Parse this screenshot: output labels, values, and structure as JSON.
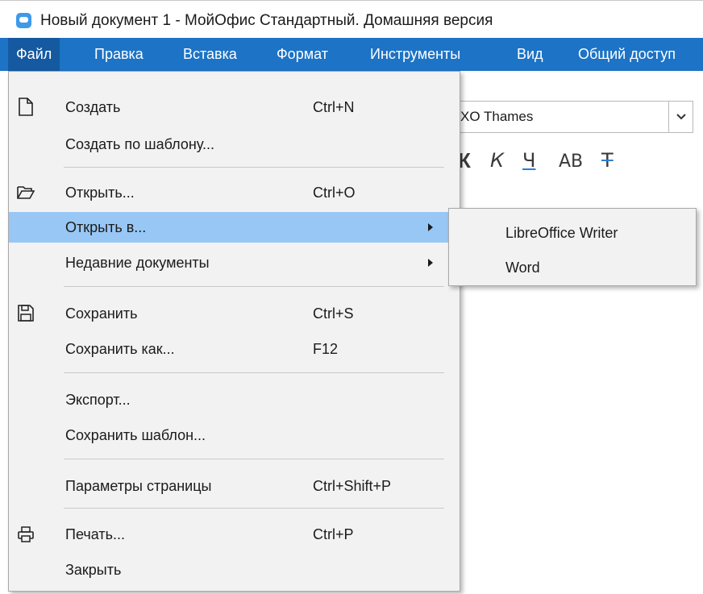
{
  "window": {
    "title": "Новый документ 1 - МойОфис Стандартный. Домашняя версия",
    "icon": "myoffice-app-icon",
    "accent": "#1d73c5"
  },
  "menubar": {
    "items": [
      {
        "label": "Файл"
      },
      {
        "label": "Правка"
      },
      {
        "label": "Вставка"
      },
      {
        "label": "Формат"
      },
      {
        "label": "Инструменты"
      },
      {
        "label": "Вид"
      },
      {
        "label": "Общий доступ"
      }
    ]
  },
  "toolbar": {
    "font_value": "XO Thames",
    "format_buttons": [
      "К",
      "К",
      "Ч",
      "АВ",
      "Т"
    ]
  },
  "file_menu": {
    "highlight_color": "#98c7f5",
    "items": [
      {
        "label": "Создать",
        "shortcut": "Ctrl+N",
        "icon": "new-document-icon"
      },
      {
        "label": "Создать по шаблону...",
        "shortcut": ""
      },
      {
        "label": "Открыть...",
        "shortcut": "Ctrl+O",
        "icon": "folder-open-icon"
      },
      {
        "label": "Открыть в...",
        "shortcut": "",
        "submenu": true
      },
      {
        "label": "Недавние документы",
        "shortcut": "",
        "submenu": true
      },
      {
        "label": "Сохранить",
        "shortcut": "Ctrl+S",
        "icon": "save-icon"
      },
      {
        "label": "Сохранить как...",
        "shortcut": "F12"
      },
      {
        "label": "Экспорт...",
        "shortcut": ""
      },
      {
        "label": "Сохранить шаблон...",
        "shortcut": ""
      },
      {
        "label": "Параметры страницы",
        "shortcut": "Ctrl+Shift+P"
      },
      {
        "label": "Печать...",
        "shortcut": "Ctrl+P",
        "icon": "printer-icon"
      },
      {
        "label": "Закрыть",
        "shortcut": ""
      }
    ]
  },
  "open_in_submenu": {
    "items": [
      {
        "label": "LibreOffice Writer"
      },
      {
        "label": "Word"
      }
    ]
  }
}
